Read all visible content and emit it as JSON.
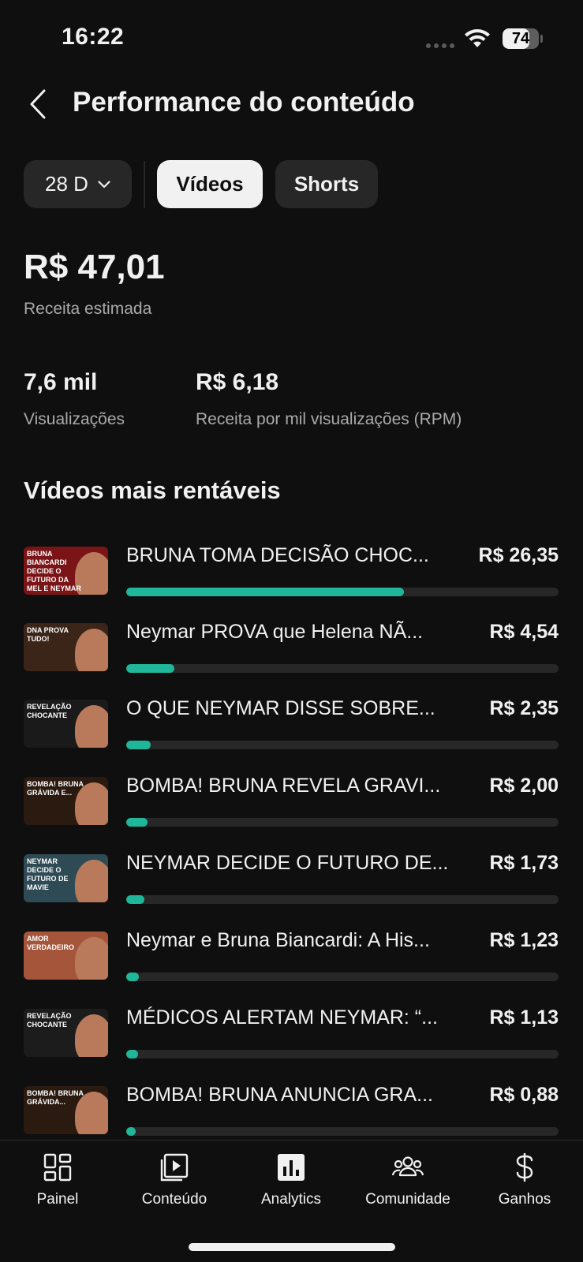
{
  "status_bar": {
    "time": "16:22",
    "battery": "74",
    "battery_level": 0.74
  },
  "header": {
    "title": "Performance do conteúdo",
    "back_icon": "chevron-left-icon"
  },
  "filters": {
    "period": "28 D",
    "tabs": [
      {
        "label": "Vídeos",
        "active": true
      },
      {
        "label": "Shorts",
        "active": false
      }
    ]
  },
  "summary": {
    "revenue_value": "R$ 47,01",
    "revenue_label": "Receita estimada",
    "views_value": "7,6 mil",
    "views_label": "Visualizações",
    "rpm_value": "R$ 6,18",
    "rpm_label": "Receita por mil visualizações (RPM)"
  },
  "top_videos": {
    "title": "Vídeos mais rentáveis",
    "items": [
      {
        "title": "BRUNA TOMA DECISÃO CHOC...",
        "value": "R$ 26,35",
        "share": 0.6428,
        "thumb_text": "BRUNA BIANCARDI DECIDE O FUTURO DA MEL E NEYMAR",
        "thumb_color": "#7a1416"
      },
      {
        "title": "Neymar PROVA que Helena NÃ...",
        "value": "R$ 4,54",
        "share": 0.1107,
        "thumb_text": "DNA PROVA TUDO!",
        "thumb_color": "#3b2418"
      },
      {
        "title": "O QUE NEYMAR DISSE SOBRE...",
        "value": "R$ 2,35",
        "share": 0.0573,
        "thumb_text": "REVELAÇÃO CHOCANTE",
        "thumb_color": "#1a1a1a"
      },
      {
        "title": "BOMBA! BRUNA REVELA GRAVI...",
        "value": "R$ 2,00",
        "share": 0.0488,
        "thumb_text": "BOMBA! BRUNA GRÁVIDA E...",
        "thumb_color": "#2a1a10"
      },
      {
        "title": "NEYMAR DECIDE O FUTURO DE...",
        "value": "R$ 1,73",
        "share": 0.0422,
        "thumb_text": "NEYMAR DECIDE O FUTURO DE MAVIE",
        "thumb_color": "#2e4a55"
      },
      {
        "title": "Neymar e Bruna Biancardi: A His...",
        "value": "R$ 1,23",
        "share": 0.03,
        "thumb_text": "AMOR VERDADEIRO",
        "thumb_color": "#a4553a"
      },
      {
        "title": "MÉDICOS ALERTAM NEYMAR: “...",
        "value": "R$ 1,13",
        "share": 0.0276,
        "thumb_text": "REVELAÇÃO CHOCANTE",
        "thumb_color": "#1c1c1c"
      },
      {
        "title": "BOMBA! BRUNA ANUNCIA GRA...",
        "value": "R$ 0,88",
        "share": 0.0215,
        "thumb_text": "BOMBA! BRUNA GRÁVIDA...",
        "thumb_color": "#2a1a10"
      }
    ]
  },
  "bottom_nav": {
    "items": [
      {
        "label": "Painel",
        "icon": "dashboard-icon",
        "active": false
      },
      {
        "label": "Conteúdo",
        "icon": "content-icon",
        "active": false
      },
      {
        "label": "Analytics",
        "icon": "analytics-icon",
        "active": true
      },
      {
        "label": "Comunidade",
        "icon": "community-icon",
        "active": false
      },
      {
        "label": "Ganhos",
        "icon": "earnings-icon",
        "active": false
      }
    ]
  },
  "colors": {
    "accent": "#1fb69a",
    "background": "#0f0f0f",
    "surface": "#272727",
    "muted_text": "#aaaaaa"
  }
}
